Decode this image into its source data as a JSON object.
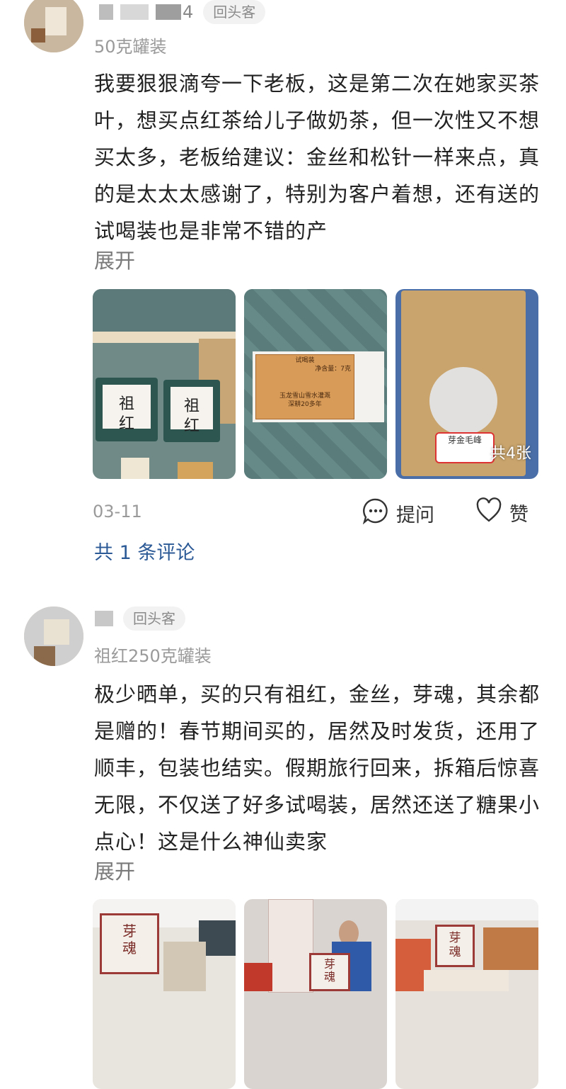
{
  "reviews": [
    {
      "name_suffix": "4",
      "badge": "回头客",
      "spec": "50克罐装",
      "content": "我要狠狠滴夸一下老板，这是第二次在她家买茶叶，想买点红茶给儿子做奶茶，但一次性又不想买太多，老板给建议：金丝和松针一样来点，真的是太太太感谢了，特别为客户着想，还有送的试喝装也是非常不错的产",
      "expand": "展开",
      "photos": [
        {
          "tin_text_1": "祖",
          "tin_text_2": "红"
        },
        {
          "card_title": "试喝装",
          "card_line_1": "玉龙雪山雪水灌溉",
          "card_line_2": "深耕20多年",
          "card_line_3": "净含量：7克"
        },
        {
          "pouch_label": "芽金毛峰",
          "count": "共4张"
        }
      ],
      "date": "03-11",
      "ask_label": "提问",
      "like_label": "赞",
      "comments": "共 1 条评论"
    },
    {
      "badge": "回头客",
      "spec": "祖红250克罐装",
      "content": "极少晒单，买的只有祖红，金丝，芽魂，其余都是赠的！春节期间买的，居然及时发货，还用了顺丰，包装也结实。假期旅行回来，拆箱后惊喜无限，不仅送了好多试喝装，居然还送了糖果小点心！这是什么神仙卖家",
      "expand": "展开",
      "photos": [
        {
          "box_text_1": "芽",
          "box_text_2": "魂"
        },
        {
          "box_text_1": "芽",
          "box_text_2": "魂"
        },
        {
          "box_text_1": "芽",
          "box_text_2": "魂"
        }
      ]
    }
  ],
  "colors": {
    "link": "#2c5a96",
    "muted": "#9a9a9a",
    "badge_bg": "#f2f2f2",
    "tin": "#2e5650",
    "box_red": "#9b3a36"
  }
}
